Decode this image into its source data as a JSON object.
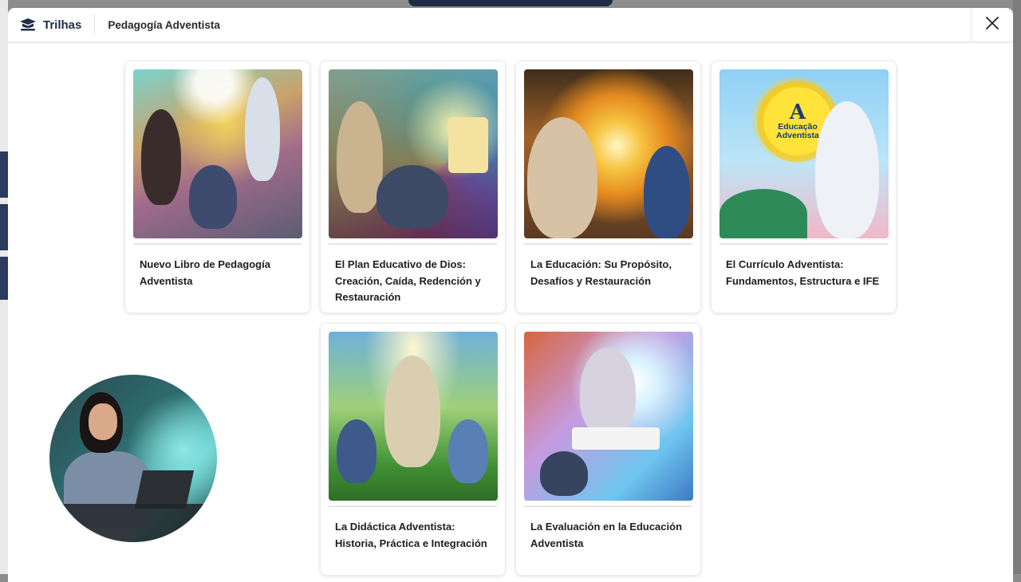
{
  "header": {
    "brand": "Trilhas",
    "title": "Pedagogía Adventista"
  },
  "cards": [
    {
      "title": "Nuevo Libro de Pedagogía Adventista",
      "image": "teacher-and-students-illustration"
    },
    {
      "title": "El Plan Educativo de Dios: Creación, Caída, Redención y Restauración",
      "image": "jesus-teaching-children-illustration"
    },
    {
      "title": "La Educación: Su Propósito, Desafíos y Restauración",
      "image": "jesus-and-student-handshake-illustration"
    },
    {
      "title": "El Currículo Adventista: Fundamentos, Estructura e IFE",
      "image": "student-with-educacao-adventista-logo",
      "logo_text": [
        "Educação",
        "Adventista"
      ]
    },
    {
      "title": "La Didáctica Adventista: Historia, Práctica e Integración",
      "image": "jesus-with-children-in-nature-illustration"
    },
    {
      "title": "La Evaluación en la Educación Adventista",
      "image": "jesus-helping-students-study-illustration"
    }
  ],
  "colors": {
    "brand": "#1f2d48",
    "backdrop": "#8c8c8c",
    "modal_bg": "#ffffff"
  },
  "icons": {
    "brand": "book-stack-icon",
    "close": "close-icon"
  }
}
